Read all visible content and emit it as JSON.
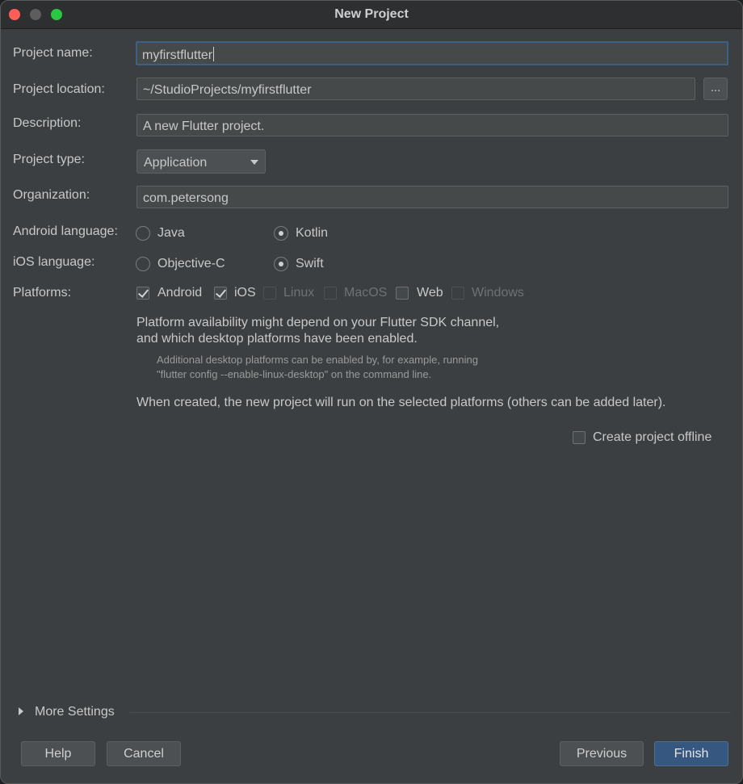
{
  "window": {
    "title": "New Project"
  },
  "form": {
    "project_name": {
      "label": "Project name:",
      "value": "myfirstflutter"
    },
    "project_location": {
      "label": "Project location:",
      "value": "~/StudioProjects/myfirstflutter",
      "browse_label": "..."
    },
    "description": {
      "label": "Description:",
      "value": "A new Flutter project."
    },
    "project_type": {
      "label": "Project type:",
      "selected": "Application"
    },
    "organization": {
      "label": "Organization:",
      "value": "com.petersong"
    },
    "android_language": {
      "label": "Android language:",
      "options": [
        {
          "label": "Java",
          "checked": false
        },
        {
          "label": "Kotlin",
          "checked": true
        }
      ]
    },
    "ios_language": {
      "label": "iOS language:",
      "options": [
        {
          "label": "Objective-C",
          "checked": false
        },
        {
          "label": "Swift",
          "checked": true
        }
      ]
    },
    "platforms": {
      "label": "Platforms:",
      "items": [
        {
          "label": "Android",
          "checked": true,
          "enabled": true
        },
        {
          "label": "iOS",
          "checked": true,
          "enabled": true
        },
        {
          "label": "Linux",
          "checked": false,
          "enabled": false
        },
        {
          "label": "MacOS",
          "checked": false,
          "enabled": false
        },
        {
          "label": "Web",
          "checked": false,
          "enabled": true
        },
        {
          "label": "Windows",
          "checked": false,
          "enabled": false
        }
      ]
    },
    "info": {
      "availability_line1": "Platform availability might depend on your Flutter SDK channel,",
      "availability_line2": "and which desktop platforms have been enabled.",
      "hint_line1": "Additional desktop platforms can be enabled by, for example, running",
      "hint_line2": "\"flutter config --enable-linux-desktop\" on the command line.",
      "created_note": "When created, the new project will run on the selected platforms (others can be added later)."
    },
    "offline": {
      "label": "Create project offline",
      "checked": false
    }
  },
  "more_settings": {
    "label": "More Settings"
  },
  "buttons": {
    "help": "Help",
    "cancel": "Cancel",
    "previous": "Previous",
    "finish": "Finish"
  }
}
